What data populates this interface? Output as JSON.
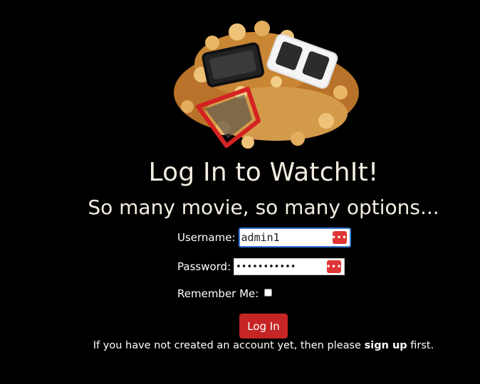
{
  "colors": {
    "background": "#000000",
    "heading_text": "#f3ede1",
    "button": "#c62525",
    "focus_ring": "#3b7bd9",
    "password_manager_key": "#e03535"
  },
  "hero": {
    "icon": "popcorn-with-3d-glasses-image"
  },
  "heading": {
    "title": "Log In to WatchIt!",
    "subtitle": "So many movie, so many options..."
  },
  "form": {
    "username": {
      "label": "Username:",
      "value": "admin1",
      "focused": true,
      "autofill_icon": "password-manager-key-icon"
    },
    "password": {
      "label": "Password:",
      "value": "adminpass12",
      "autofill_icon": "password-manager-key-icon"
    },
    "remember": {
      "label": "Remember Me:",
      "checked": false
    },
    "submit_label": "Log In"
  },
  "footer": {
    "prefix": "If you have not created an account yet, then please ",
    "link": "sign up",
    "suffix": " first."
  }
}
